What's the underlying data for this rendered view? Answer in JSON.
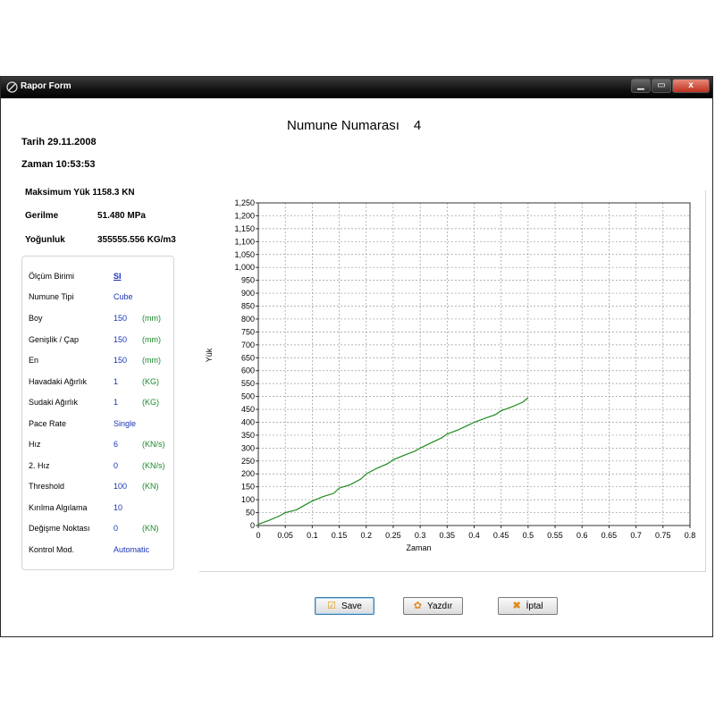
{
  "window": {
    "title": "Rapor Form",
    "close_glyph": "x",
    "min_glyph": "▁",
    "max_glyph": "▭"
  },
  "heading": {
    "label": "Numune Numarası",
    "number": "4"
  },
  "info": {
    "tarih": "Tarih   29.11.2008",
    "zaman": "Zaman 10:53:53"
  },
  "stats": [
    {
      "label": "Maksimum Yük 1158.3 KN",
      "value": ""
    },
    {
      "label": "Gerilme",
      "value": "51.480 MPa"
    },
    {
      "label": "Yoğunluk",
      "value": "355555.556 KG/m3"
    }
  ],
  "params": [
    {
      "label": "Ölçüm Birimi",
      "value": "SI",
      "unit": "",
      "link": true
    },
    {
      "label": "Numune Tipi",
      "value": "Cube",
      "unit": ""
    },
    {
      "label": "Boy",
      "value": "150",
      "unit": "(mm)"
    },
    {
      "label": "Genişlik / Çap",
      "value": "150",
      "unit": "(mm)"
    },
    {
      "label": "En",
      "value": "150",
      "unit": "(mm)"
    },
    {
      "label": "Havadaki Ağırlık",
      "value": "1",
      "unit": "(KG)"
    },
    {
      "label": "Sudaki Ağırlık",
      "value": "1",
      "unit": "(KG)"
    },
    {
      "label": "Pace Rate",
      "value": "Single",
      "unit": ""
    },
    {
      "label": "Hız",
      "value": "6",
      "unit": "(KN/s)"
    },
    {
      "label": "2. Hız",
      "value": "0",
      "unit": "(KN/s)"
    },
    {
      "label": "Threshold",
      "value": "100",
      "unit": "(KN)"
    },
    {
      "label": "Kırılma Algılama",
      "value": "10",
      "unit": ""
    },
    {
      "label": "Değişme Noktası",
      "value": "0",
      "unit": "(KN)"
    },
    {
      "label": "Kontrol Mod.",
      "value": "Automatic",
      "unit": ""
    }
  ],
  "buttons": {
    "save": "Save",
    "print": "Yazdır",
    "cancel": "İptal"
  },
  "icons": {
    "save": "checkbox-icon",
    "print": "paw-icon",
    "cancel": "x-icon"
  },
  "chart_data": {
    "type": "line",
    "xlabel": "Zaman",
    "ylabel": "Yük",
    "xlim": [
      0,
      0.8
    ],
    "ylim": [
      0,
      1250
    ],
    "x_ticks": [
      "0",
      "0.05",
      "0.1",
      "0.15",
      "0.2",
      "0.25",
      "0.3",
      "0.35",
      "0.4",
      "0.45",
      "0.5",
      "0.55",
      "0.6",
      "0.65",
      "0.7",
      "0.75",
      "0.8"
    ],
    "y_ticks": [
      "0",
      "50",
      "100",
      "150",
      "200",
      "250",
      "300",
      "350",
      "400",
      "450",
      "500",
      "550",
      "600",
      "650",
      "700",
      "750",
      "800",
      "850",
      "900",
      "950",
      "1,000",
      "1,050",
      "1,100",
      "1,150",
      "1,200",
      "1,250"
    ],
    "grid": true,
    "series": [
      {
        "color": "#1e8a1e",
        "x": [
          0,
          0.02,
          0.04,
          0.05,
          0.07,
          0.08,
          0.1,
          0.12,
          0.14,
          0.15,
          0.17,
          0.19,
          0.2,
          0.22,
          0.24,
          0.25,
          0.27,
          0.29,
          0.3,
          0.32,
          0.34,
          0.35,
          0.37,
          0.39,
          0.4,
          0.42,
          0.44,
          0.45,
          0.47,
          0.49,
          0.5
        ],
        "y": [
          5,
          20,
          38,
          50,
          60,
          72,
          95,
          112,
          125,
          145,
          158,
          180,
          200,
          222,
          240,
          255,
          272,
          288,
          300,
          320,
          340,
          355,
          370,
          390,
          400,
          415,
          430,
          445,
          460,
          478,
          495
        ]
      }
    ]
  }
}
